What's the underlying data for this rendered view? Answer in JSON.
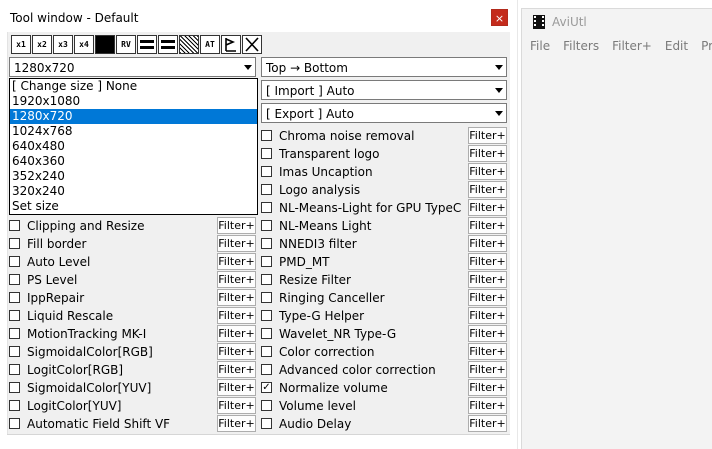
{
  "tool_window": {
    "title": "Tool window - Default",
    "close_glyph": "×",
    "toolbar": [
      {
        "name": "size-1x-icon",
        "label": "x1"
      },
      {
        "name": "size-2x-icon",
        "label": "x2"
      },
      {
        "name": "size-3x-icon",
        "label": "x3"
      },
      {
        "name": "size-4x-icon",
        "label": "x4"
      },
      {
        "name": "black-square-icon",
        "label": ""
      },
      {
        "name": "rv-icon",
        "label": "RV"
      },
      {
        "name": "equal-bars-icon",
        "label": ""
      },
      {
        "name": "equal-bars-icon-2",
        "label": ""
      },
      {
        "name": "hatch-icon",
        "label": ""
      },
      {
        "name": "at-icon",
        "label": "AT"
      },
      {
        "name": "flag-icon",
        "label": ""
      },
      {
        "name": "close-x-icon",
        "label": ""
      }
    ],
    "size_combo": {
      "value": "1280x720"
    },
    "size_options": [
      "[ Change size ] None",
      "1920x1080",
      "1280x720",
      "1024x768",
      "640x480",
      "640x360",
      "352x240",
      "320x240",
      "Set size"
    ],
    "selected_size_index": 2,
    "order_combo": {
      "value": "Top → Bottom"
    },
    "import_combo": {
      "value": "[ Import ] Auto"
    },
    "export_combo": {
      "value": "[ Export ] Auto"
    },
    "filter_button_label": "Filter+",
    "left_filters": [
      {
        "label": "Clipping and Resize",
        "checked": false
      },
      {
        "label": "Fill border",
        "checked": false
      },
      {
        "label": "Auto Level",
        "checked": false
      },
      {
        "label": "PS Level",
        "checked": false
      },
      {
        "label": "IppRepair",
        "checked": false
      },
      {
        "label": "Liquid Rescale",
        "checked": false
      },
      {
        "label": "MotionTracking MK-I",
        "checked": false
      },
      {
        "label": "SigmoidalColor[RGB]",
        "checked": false
      },
      {
        "label": "LogitColor[RGB]",
        "checked": false
      },
      {
        "label": "SigmoidalColor[YUV]",
        "checked": false
      },
      {
        "label": "LogitColor[YUV]",
        "checked": false
      },
      {
        "label": "Automatic Field Shift VF",
        "checked": false
      }
    ],
    "right_filters": [
      {
        "label": "Chroma noise removal",
        "checked": false
      },
      {
        "label": "Transparent logo",
        "checked": false
      },
      {
        "label": "Imas Uncaption",
        "checked": false
      },
      {
        "label": "Logo analysis",
        "checked": false
      },
      {
        "label": "NL-Means-Light for GPU TypeC",
        "checked": false
      },
      {
        "label": "NL-Means Light",
        "checked": false
      },
      {
        "label": "NNEDI3 filter",
        "checked": false
      },
      {
        "label": "PMD_MT",
        "checked": false
      },
      {
        "label": "Resize Filter",
        "checked": false
      },
      {
        "label": "Ringing Canceller",
        "checked": false
      },
      {
        "label": "Type-G Helper",
        "checked": false
      },
      {
        "label": "Wavelet_NR Type-G",
        "checked": false
      },
      {
        "label": "Color correction",
        "checked": false
      },
      {
        "label": "Advanced color correction",
        "checked": false
      },
      {
        "label": "Normalize volume",
        "checked": true
      },
      {
        "label": "Volume level",
        "checked": false
      },
      {
        "label": "Audio Delay",
        "checked": false
      }
    ]
  },
  "main_window": {
    "title": "AviUtl",
    "menu": [
      "File",
      "Filters",
      "Filter+",
      "Edit",
      "Profi"
    ]
  },
  "colors": {
    "selection": "#0078d7",
    "close_button": "#c42b1c",
    "client_background": "#f0f0f0"
  }
}
